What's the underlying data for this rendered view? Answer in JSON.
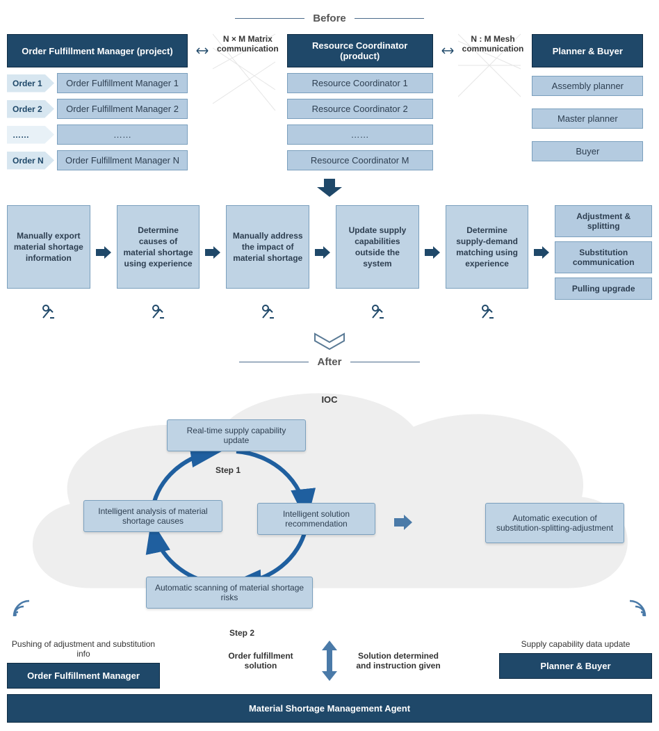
{
  "headers": {
    "before": "Before",
    "after": "After"
  },
  "roles": {
    "left_header": "Order Fulfillment Manager (project)",
    "mid_header": "Resource Coordinator (product)",
    "right_header": "Planner & Buyer"
  },
  "orders": {
    "o1": "Order 1",
    "o2": "Order 2",
    "dots": "……",
    "on": "Order N"
  },
  "ofm": {
    "m1": "Order Fulfillment Manager 1",
    "m2": "Order Fulfillment Manager 2",
    "dots": "……",
    "mn": "Order Fulfillment Manager N"
  },
  "rc": {
    "r1": "Resource Coordinator 1",
    "r2": "Resource Coordinator 2",
    "dots": "……",
    "rm": "Resource Coordinator M"
  },
  "comm": {
    "matrix": "N × M Matrix communication",
    "mesh": "N : M Mesh communication"
  },
  "planners": {
    "p1": "Assembly planner",
    "p2": "Master planner",
    "p3": "Buyer"
  },
  "process": {
    "s1": "Manually export material shortage information",
    "s2": "Determine causes of material shortage using experience",
    "s3": "Manually address the impact of material shortage",
    "s4": "Update supply capabilities outside the system",
    "s5": "Determine supply-demand matching using experience",
    "out1": "Adjustment & splitting",
    "out2": "Substitution communication",
    "out3": "Pulling upgrade"
  },
  "after": {
    "ioc": "IOC",
    "n_top": "Real-time supply capability update",
    "n_left": "Intelligent analysis of material shortage causes",
    "n_right": "Intelligent solution recommendation",
    "n_bot": "Automatic scanning of material shortage risks",
    "step1": "Step 1",
    "step2": "Step 2",
    "auto": "Automatic execution of substitution-splitting-adjustment",
    "left_note": "Pushing of adjustment and substitution info",
    "right_note": "Supply capability data update",
    "left_role": "Order Fulfillment Manager",
    "right_role": "Planner & Buyer",
    "mid_left": "Order fulfillment solution",
    "mid_right": "Solution determined and instruction given",
    "agent": "Material Shortage Management Agent"
  }
}
